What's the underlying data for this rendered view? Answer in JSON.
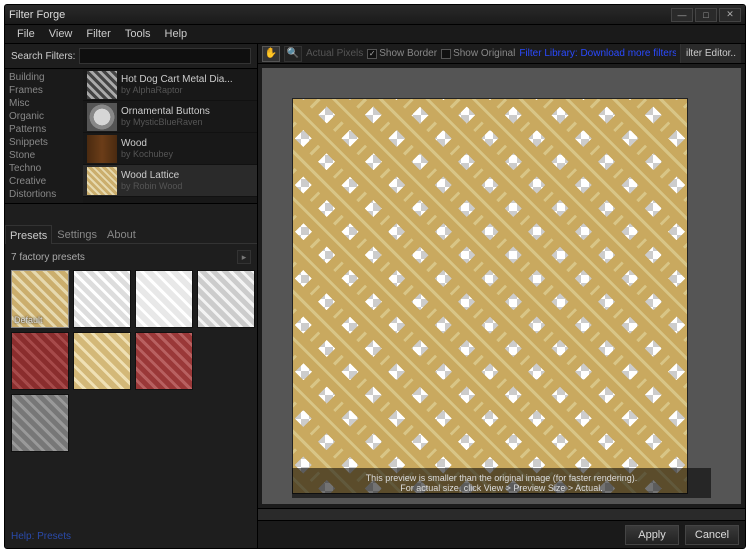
{
  "window": {
    "title": "Filter Forge"
  },
  "menu": [
    "File",
    "View",
    "Filter",
    "Tools",
    "Help"
  ],
  "search": {
    "label": "Search Filters:",
    "value": ""
  },
  "categories": [
    "Building",
    "Frames",
    "Misc",
    "Organic",
    "Patterns",
    "Snippets",
    "Stone",
    "Techno",
    "Creative",
    "Distortions",
    "Frames",
    "Misc",
    "Patterns"
  ],
  "filters": [
    {
      "name": "Hot Dog Cart Metal Dia...",
      "by": "by AlphaRaptor"
    },
    {
      "name": "Ornamental Buttons",
      "by": "by MysticBlueRaven"
    },
    {
      "name": "Wood",
      "by": "by Kochubey"
    },
    {
      "name": "Wood Lattice",
      "by": "by Robin Wood"
    }
  ],
  "tabs": [
    "Presets",
    "Settings",
    "About"
  ],
  "presets": {
    "header": "7 factory presets",
    "default_label": "Default"
  },
  "toolbar": {
    "actual_pixels": "Actual Pixels",
    "show_border": "Show Border",
    "show_original": "Show Original",
    "link": "Filter Library: Download more filters!",
    "editor": "ilter Editor.."
  },
  "hint": {
    "line1": "This preview is smaller than the original image (for faster rendering).",
    "line2": "For actual size, click View > Preview Size > Actual."
  },
  "footer": {
    "apply": "Apply",
    "cancel": "Cancel"
  },
  "help_presets": "Help: Presets"
}
